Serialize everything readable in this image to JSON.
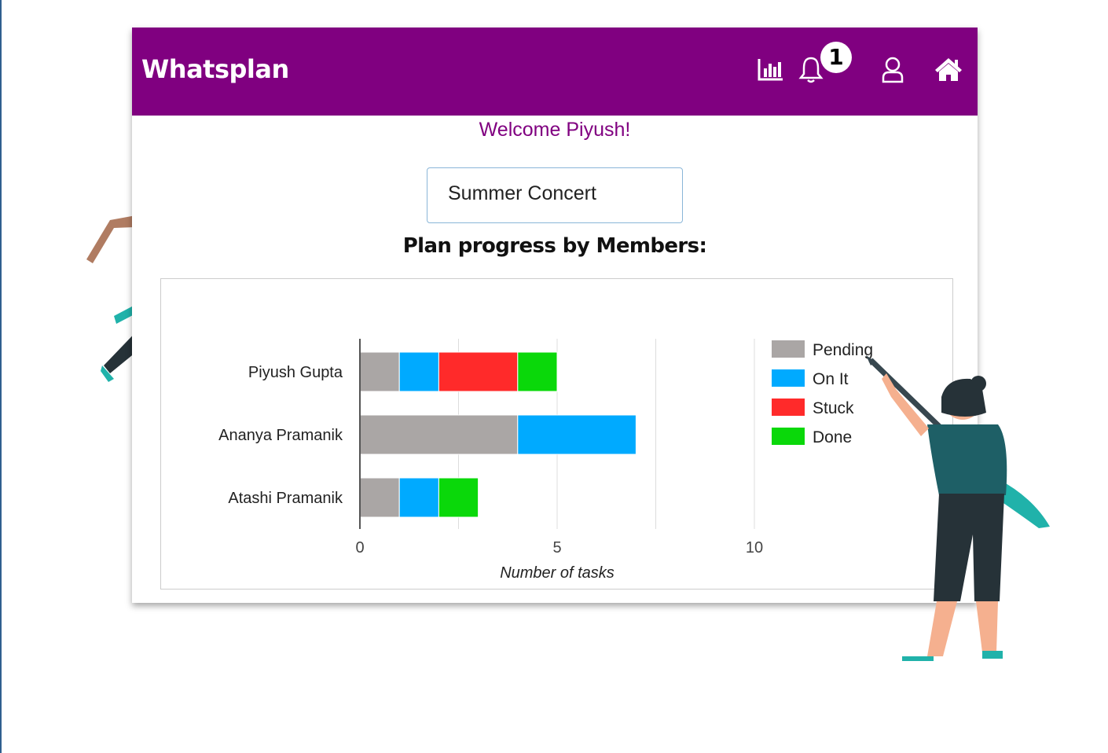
{
  "app": {
    "title": "Whatsplan"
  },
  "header": {
    "icons": [
      "bar-chart-icon",
      "bell-icon",
      "user-icon",
      "home-icon"
    ],
    "notification_count": "1"
  },
  "welcome_text": "Welcome Piyush!",
  "plan_select": {
    "value": "Summer Concert"
  },
  "section_title": "Plan progress by Members:",
  "colors": {
    "brand": "#800080",
    "pending": "#aaa6a5",
    "on_it": "#00aaff",
    "stuck": "#ff2a2a",
    "done": "#0ad80a",
    "illustration_teal": "#20b2aa"
  },
  "chart_data": {
    "type": "bar",
    "orientation": "horizontal",
    "stacked": true,
    "categories": [
      "Piyush Gupta",
      "Ananya Pramanik",
      "Atashi Pramanik"
    ],
    "series": [
      {
        "name": "Pending",
        "values": [
          1,
          4,
          1
        ],
        "color": "#aaa6a5"
      },
      {
        "name": "On It",
        "values": [
          1,
          3,
          1
        ],
        "color": "#00aaff"
      },
      {
        "name": "Stuck",
        "values": [
          2,
          0,
          0
        ],
        "color": "#ff2a2a"
      },
      {
        "name": "Done",
        "values": [
          1,
          0,
          1
        ],
        "color": "#0ad80a"
      }
    ],
    "xlabel": "Number of tasks",
    "ylabel": "",
    "xlim": [
      0,
      10
    ],
    "xticks": [
      "0",
      "5",
      "10"
    ],
    "grid": true,
    "legend_position": "right"
  }
}
